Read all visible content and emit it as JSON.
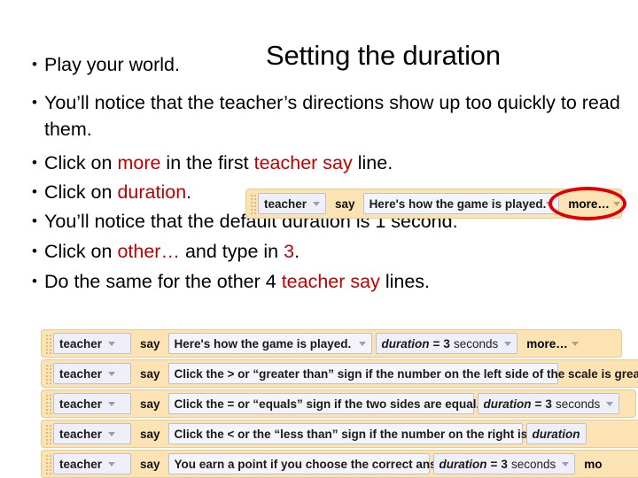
{
  "slide": {
    "title": "Setting the duration"
  },
  "bullets": [
    {
      "id": "b1",
      "parts": [
        {
          "t": "Play your world.",
          "hl": false
        }
      ]
    },
    {
      "id": "b2",
      "parts": [
        {
          "t": "You’ll notice that the teacher’s directions show up too quickly to read them.",
          "hl": false
        }
      ]
    },
    {
      "id": "b3",
      "parts": [
        {
          "t": "Click on ",
          "hl": false
        },
        {
          "t": "more",
          "hl": true
        },
        {
          "t": " in the first ",
          "hl": false
        },
        {
          "t": "teacher say",
          "hl": true
        },
        {
          "t": " line.",
          "hl": false
        }
      ]
    },
    {
      "id": "b4",
      "parts": [
        {
          "t": "Click on ",
          "hl": false
        },
        {
          "t": "duration",
          "hl": true
        },
        {
          "t": ".",
          "hl": false
        }
      ]
    },
    {
      "id": "b5",
      "parts": [
        {
          "t": "You’ll notice that the default duration is 1 second.",
          "hl": false
        }
      ]
    },
    {
      "id": "b6",
      "parts": [
        {
          "t": "Click on ",
          "hl": false
        },
        {
          "t": "other…",
          "hl": true
        },
        {
          "t": " and type in ",
          "hl": false
        },
        {
          "t": "3",
          "hl": true
        },
        {
          "t": ".",
          "hl": false
        }
      ]
    },
    {
      "id": "b7",
      "parts": [
        {
          "t": "Do the same for the other 4 ",
          "hl": false
        },
        {
          "t": "teacher say",
          "hl": true
        },
        {
          "t": " lines.",
          "hl": false
        }
      ]
    }
  ],
  "bullet_marker": "•",
  "demo_block": {
    "sprite": "teacher",
    "verb": "say",
    "message": "Here's how the game is played.",
    "more": "more…"
  },
  "scripts": [
    {
      "sprite": "teacher",
      "verb": "say",
      "message": "Here's how the game is played.",
      "duration_word": "duration",
      "duration_eq": "=",
      "duration_value": "3",
      "duration_unit": "seconds",
      "more": "more…"
    },
    {
      "sprite": "teacher",
      "verb": "say",
      "message": "Click the > or “greater than” sign if the number on the left side of the scale is great",
      "duration_word": "",
      "duration_eq": "",
      "duration_value": "",
      "duration_unit": "",
      "more": ""
    },
    {
      "sprite": "teacher",
      "verb": "say",
      "message": "Click the = or “equals” sign if the two sides are equal.",
      "duration_word": "duration",
      "duration_eq": "=",
      "duration_value": "3",
      "duration_unit": "seconds",
      "more": ""
    },
    {
      "sprite": "teacher",
      "verb": "say",
      "message": "Click the < or the “less than” sign if the number on the right is greater.",
      "duration_word": "duration",
      "duration_eq": "",
      "duration_value": "",
      "duration_unit": "",
      "more": ""
    },
    {
      "sprite": "teacher",
      "verb": "say",
      "message": "You earn a point if you choose the correct answer.",
      "duration_word": "duration",
      "duration_eq": "=",
      "duration_value": "3",
      "duration_unit": "seconds",
      "more": "mo"
    }
  ],
  "colors": {
    "highlight": "#C00000",
    "annotation": "#E00000",
    "block_body": "#FBE3B4",
    "field_bg": "#EFEFF8"
  }
}
